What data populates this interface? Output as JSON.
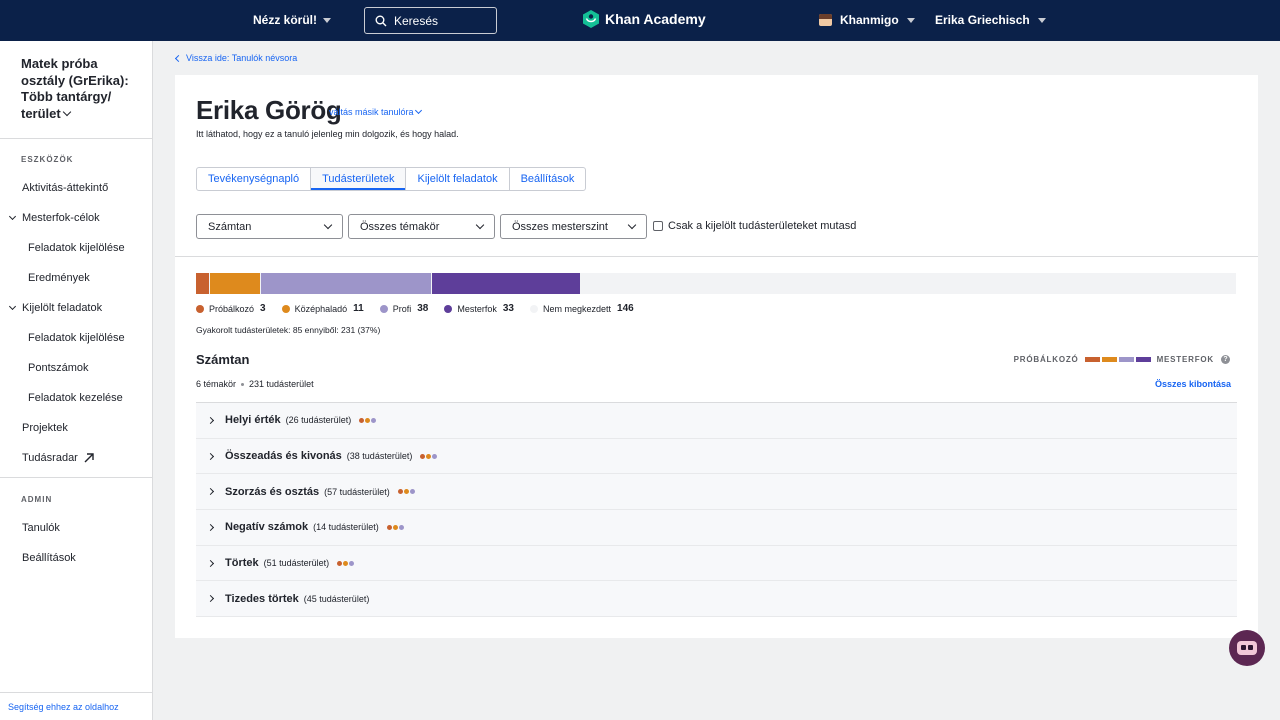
{
  "topbar": {
    "explore_label": "Nézz körül!",
    "search_placeholder": "Keresés",
    "logo_text": "Khan Academy",
    "khanmigo_label": "Khanmigo",
    "user_name": "Erika Griechisch",
    "bg_color": "#0b2149"
  },
  "sidebar": {
    "class_title": "Matek próba osztály (GrErika): Több tantárgy/ terület",
    "tools_label": "ESZKÖZÖK",
    "items": [
      {
        "label": "Aktivitás-áttekintő"
      },
      {
        "label": "Mesterfok-célok"
      },
      {
        "label": "Feladatok kijelölése"
      },
      {
        "label": "Eredmények"
      },
      {
        "label": "Kijelölt feladatok"
      },
      {
        "label": "Feladatok kijelölése"
      },
      {
        "label": "Pontszámok"
      },
      {
        "label": "Feladatok kezelése"
      },
      {
        "label": "Projektek"
      },
      {
        "label": "Tudásradar"
      }
    ],
    "admin_label": "ADMIN",
    "admin_items": [
      {
        "label": "Tanulók"
      },
      {
        "label": "Beállítások"
      }
    ],
    "help_link": "Segítség ehhez az oldalhoz"
  },
  "main": {
    "back_link": "Vissza ide: Tanulók névsora",
    "student_name": "Erika Görög",
    "switch_student": "váltás másik tanulóra",
    "subtitle": "Itt láthatod, hogy ez a tanuló jelenleg min dolgozik, és hogy halad.",
    "tabs": [
      {
        "label": "Tevékenységnapló",
        "active": false
      },
      {
        "label": "Tudásterületek",
        "active": true
      },
      {
        "label": "Kijelölt feladatok",
        "active": false
      },
      {
        "label": "Beállítások",
        "active": false
      }
    ],
    "filters": {
      "subject": "Számtan",
      "topics": "Összes témakör",
      "mastery": "Összes mesterszint",
      "only_assigned_label": "Csak a kijelölt tudásterületeket mutasd",
      "only_assigned_checked": false
    },
    "progress": {
      "total": 231,
      "segments": [
        {
          "label": "Próbálkozó",
          "count": 3,
          "color": "#c8612f"
        },
        {
          "label": "Középhaladó",
          "count": 11,
          "color": "#de8a1d"
        },
        {
          "label": "Profi",
          "count": 38,
          "color": "#9d95c9"
        },
        {
          "label": "Mesterfok",
          "count": 33,
          "color": "#5e3e9a"
        },
        {
          "label": "Nem megkezdett",
          "count": 146,
          "color": "#f2f3f5"
        }
      ],
      "practiced_text": "Gyakorolt tudásterületek: 85 ennyiből: 231 (37%)"
    },
    "section": {
      "title": "Számtan",
      "mastery_start": "PRÓBÁLKOZÓ",
      "mastery_end": "MESTERFOK",
      "help_glyph": "?",
      "topics_count": "6 témakör",
      "skills_count": "231 tudásterület",
      "expand_all": "Összes kibontása"
    },
    "units": [
      {
        "name": "Helyi érték",
        "count": "(26 tudásterület)"
      },
      {
        "name": "Összeadás és kivonás",
        "count": "(38 tudásterület)"
      },
      {
        "name": "Szorzás és osztás",
        "count": "(57 tudásterület)"
      },
      {
        "name": "Negatív számok",
        "count": "(14 tudásterület)"
      },
      {
        "name": "Törtek",
        "count": "(51 tudásterület)"
      },
      {
        "name": "Tizedes törtek",
        "count": "(45 tudásterület)"
      }
    ]
  }
}
